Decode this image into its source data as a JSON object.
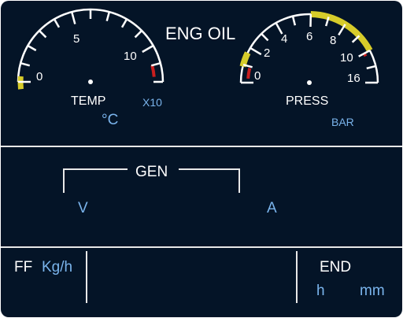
{
  "header": {
    "title": "ENG OIL"
  },
  "temp_gauge": {
    "label": "TEMP",
    "multiplier": "X10",
    "unit": "°C",
    "ticks": [
      "0",
      "5",
      "10"
    ],
    "range": [
      0,
      12
    ],
    "caution_band": [
      -0.4,
      0.3
    ],
    "limit_band": [
      11.0,
      11.7
    ],
    "caution_color": "#d7cc2a",
    "limit_color": "#c81e1e"
  },
  "press_gauge": {
    "label": "PRESS",
    "unit": "BAR",
    "ticks": [
      "0",
      "2",
      "4",
      "6",
      "8",
      "10",
      "16"
    ],
    "caution_low_band": [
      0.9,
      1.7
    ],
    "normal_band": [
      6.0,
      10.0
    ],
    "limit_band": [
      10.0,
      10.6
    ],
    "caution_color": "#d7cc2a",
    "limit_color": "#c81e1e"
  },
  "gen": {
    "label": "GEN",
    "volts_unit": "V",
    "amps_unit": "A"
  },
  "fuel_flow": {
    "label": "FF",
    "unit": "Kg/h"
  },
  "endurance": {
    "label": "END",
    "hours_unit": "h",
    "minutes_unit": "mm"
  }
}
